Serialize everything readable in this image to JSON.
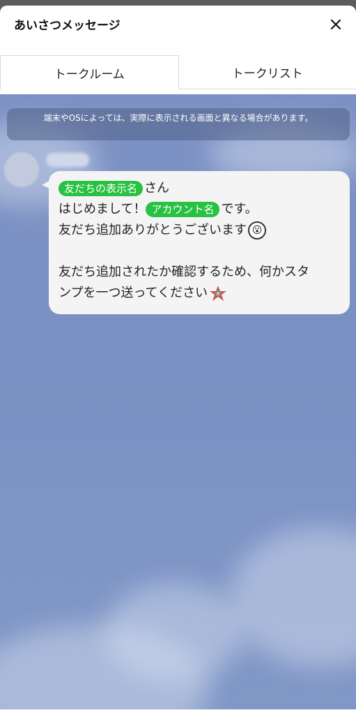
{
  "header": {
    "title": "あいさつメッセージ",
    "close_icon": "close-icon"
  },
  "tabs": [
    {
      "label": "トークルーム",
      "active": true
    },
    {
      "label": "トークリスト",
      "active": false
    }
  ],
  "chat": {
    "notice": "端末やOSによっては、実際に表示される画面と異なる場合があります。",
    "message": {
      "line1_tag": "友だちの表示名",
      "line1_text": "さん",
      "line2_text_a": "はじめまして！",
      "line2_tag": "アカウント名",
      "line2_text_b": "です。",
      "line3_text": "友だち追加ありがとうございます",
      "line3_emoji": "surprised-face-emoji",
      "line5_text": "友だち追加されたか確認するため、何かスタ",
      "line6_text": "ンプを一つ送ってください",
      "line6_emoji": "shooting-star-emoji"
    }
  },
  "colors": {
    "tag_green": "#28c141",
    "chat_background": "#7d92c4"
  }
}
